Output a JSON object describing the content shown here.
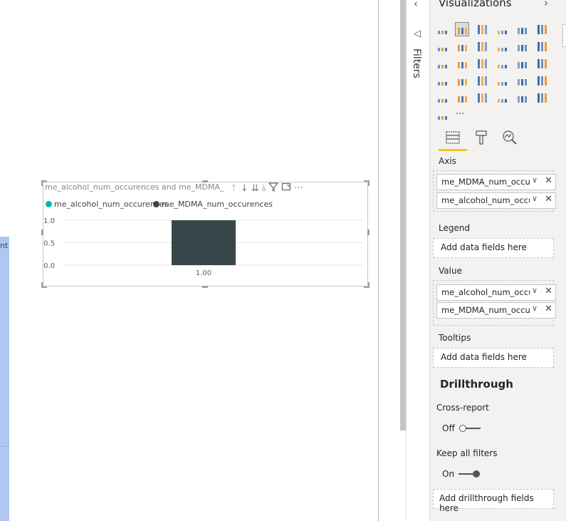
{
  "canvas": {
    "left_panel_text": "nt"
  },
  "visual": {
    "title": "me_alcohol_num_occurences and me_MDMA_num_occurences by me_MDMA_num_occurences",
    "toolbar_icons": [
      "drill-up-icon",
      "drill-down-icon",
      "expand-next-level-icon",
      "expand-all-icon",
      "filter-icon",
      "focus-mode-icon",
      "more-options-icon"
    ],
    "legend": [
      {
        "name": "me_alcohol_num_occurences",
        "color": "#01b8aa"
      },
      {
        "name": "me_MDMA_num_occurences",
        "color": "#374649"
      }
    ]
  },
  "chart_data": {
    "type": "bar",
    "categories": [
      "1.00"
    ],
    "series": [
      {
        "name": "me_alcohol_num_occurences",
        "values": [
          0
        ],
        "color": "#01b8aa"
      },
      {
        "name": "me_MDMA_num_occurences",
        "values": [
          1
        ],
        "color": "#374649"
      }
    ],
    "yticks": [
      "1.0",
      "0.5",
      "0.0"
    ],
    "ylim": [
      0,
      1
    ],
    "grid": true,
    "legend_position": "top-left"
  },
  "filters": {
    "label": "Filters",
    "chevron": "‹"
  },
  "visualizations": {
    "title": "Visualizations",
    "chevron": "›",
    "selected_icon": "clustered-column-chart-icon",
    "tabs": [
      "fields-tab-icon",
      "format-tab-icon",
      "analytics-tab-icon"
    ],
    "axis_label": "Axis",
    "axis_fields": [
      "me_MDMA_num_occurences",
      "me_alcohol_num_occurences"
    ],
    "legend_label": "Legend",
    "legend_placeholder": "Add data fields here",
    "value_label": "Value",
    "value_fields": [
      "me_alcohol_num_occurences",
      "me_MDMA_num_occurences"
    ],
    "tooltips_label": "Tooltips",
    "tooltips_placeholder": "Add data fields here",
    "drillthrough_title": "Drillthrough",
    "cross_report_label": "Cross-report",
    "cross_report_state": "Off",
    "keep_filters_label": "Keep all filters",
    "keep_filters_state": "On",
    "drillthrough_placeholder": "Add drillthrough fields here",
    "pill_chevron": "∨",
    "pill_remove": "✕",
    "more_visuals": "···"
  },
  "colors": {
    "accent": "#f2c811",
    "selection_tab": "#f2c811"
  }
}
